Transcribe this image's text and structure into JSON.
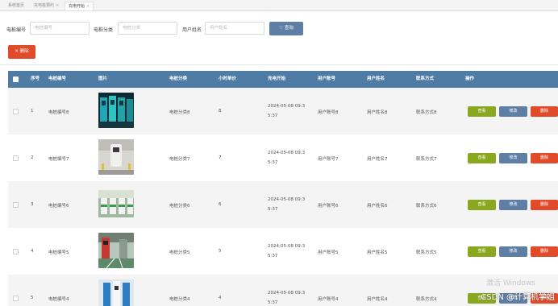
{
  "tabs": [
    {
      "label": "系统首页",
      "close": ""
    },
    {
      "label": "充电桩预约",
      "close": "×"
    },
    {
      "label": "充电开始",
      "close": "×"
    }
  ],
  "search": {
    "label1": "电桩编号",
    "placeholder1": "电桩编号",
    "label2": "电桩分类",
    "placeholder2": "电桩分类",
    "label3": "用户姓名",
    "placeholder3": "用户姓名",
    "button": "♡ 查询"
  },
  "delete_button": "✕ 删除",
  "columns": [
    "序号",
    "电桩编号",
    "图片",
    "电桩分类",
    "小时单价",
    "充电开始",
    "用户账号",
    "用户姓名",
    "联系方式",
    "操作"
  ],
  "rows": [
    {
      "no": "1",
      "code": "电桩编号8",
      "category": "电桩分类8",
      "price": "8",
      "start1": "2024-05-08 09:3",
      "start2": "5:37",
      "account": "用户账号8",
      "name": "用户姓名8",
      "contact": "联系方式8",
      "view": "查看",
      "edit": "修改",
      "delete": "删除"
    },
    {
      "no": "2",
      "code": "电桩编号7",
      "category": "电桩分类7",
      "price": "7",
      "start1": "2024-05-08 09:3",
      "start2": "5:37",
      "account": "用户账号7",
      "name": "用户姓名7",
      "contact": "联系方式7",
      "view": "查看",
      "edit": "修改",
      "delete": "删除"
    },
    {
      "no": "3",
      "code": "电桩编号6",
      "category": "电桩分类6",
      "price": "6",
      "start1": "2024-05-08 09:3",
      "start2": "5:37",
      "account": "用户账号6",
      "name": "用户姓名6",
      "contact": "联系方式6",
      "view": "查看",
      "edit": "修改",
      "delete": "删除"
    },
    {
      "no": "4",
      "code": "电桩编号5",
      "category": "电桩分类5",
      "price": "5",
      "start1": "2024-05-08 09:3",
      "start2": "5:37",
      "account": "用户账号5",
      "name": "用户姓名5",
      "contact": "联系方式5",
      "view": "查看",
      "edit": "修改",
      "delete": "删除"
    },
    {
      "no": "5",
      "code": "电桩编号4",
      "category": "电桩分类4",
      "price": "4",
      "start1": "2024-05-08 09:3",
      "start2": "5:37",
      "account": "用户账号4",
      "name": "用户姓名4",
      "contact": "联系方式4",
      "view": "查看",
      "edit": "修改",
      "delete": "删除"
    }
  ],
  "watermark": "激活 Windows",
  "csdn_mark": "CSDN @计算机学姐",
  "colors": {
    "header": "#4f7ca5",
    "search_btn": "#5e7ea6",
    "view_btn": "#8aa81f",
    "edit_btn": "#5e7ea6",
    "delete_btn": "#e14b2a"
  }
}
